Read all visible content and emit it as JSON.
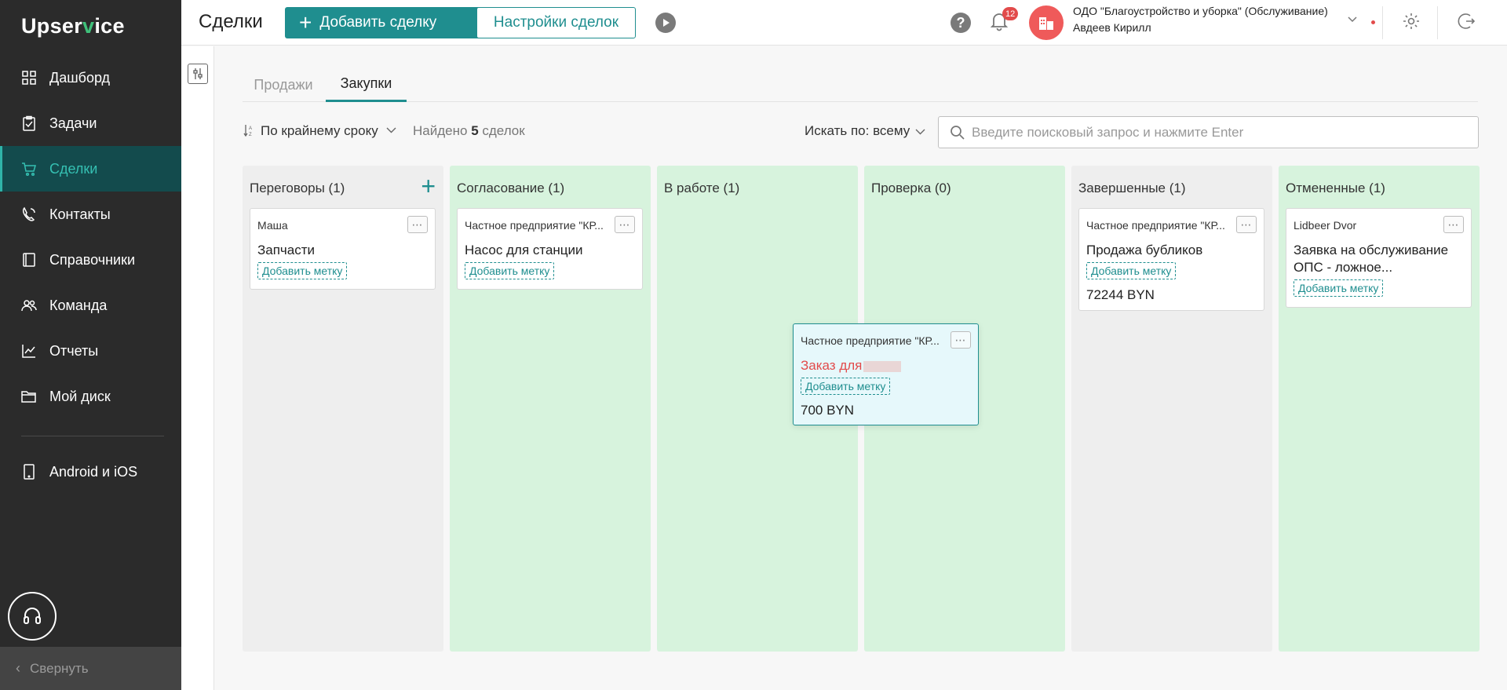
{
  "app": {
    "logo_a": "Upser",
    "logo_v": "v",
    "logo_b": "ice"
  },
  "sidebar": {
    "items": [
      {
        "label": "Дашборд",
        "icon": "dashboard-icon"
      },
      {
        "label": "Задачи",
        "icon": "tasks-icon"
      },
      {
        "label": "Сделки",
        "icon": "deals-icon",
        "active": true
      },
      {
        "label": "Контакты",
        "icon": "contacts-icon"
      },
      {
        "label": "Справочники",
        "icon": "reference-book-icon"
      },
      {
        "label": "Команда",
        "icon": "team-icon"
      },
      {
        "label": "Отчеты",
        "icon": "reports-icon"
      },
      {
        "label": "Мой диск",
        "icon": "folder-icon"
      }
    ],
    "mobile_label": "Android и iOS",
    "collapse_label": "Свернуть"
  },
  "header": {
    "title": "Сделки",
    "add_button": "Добавить сделку",
    "settings_button": "Настройки сделок",
    "notifications_count": "12",
    "org_name": "ОДО \"Благоустройство и уборка\" (Обслуживание)",
    "user_name": "Авдеев Кирилл"
  },
  "tabs": [
    {
      "label": "Продажи",
      "active": false
    },
    {
      "label": "Закупки",
      "active": true
    }
  ],
  "toolbar": {
    "sort_label": "По крайнему сроку",
    "found_prefix": "Найдено",
    "found_count": "5",
    "found_suffix": "сделок",
    "search_by": "Искать по: всему",
    "search_placeholder": "Введите поисковый запрос и нажмите Enter",
    "search_value": ""
  },
  "board": {
    "add_tag_label": "Добавить метку",
    "columns": [
      {
        "title": "Переговоры (1)",
        "color": "gray",
        "cards": [
          {
            "company": "Маша",
            "title": "Запчасти",
            "amount": ""
          }
        ]
      },
      {
        "title": "Согласование (1)",
        "color": "green",
        "cards": [
          {
            "company": "Частное предприятие \"КР...",
            "title": "Насос для станции",
            "amount": ""
          }
        ]
      },
      {
        "title": "В работе (1)",
        "color": "green",
        "cards": []
      },
      {
        "title": "Проверка (0)",
        "color": "green",
        "cards": []
      },
      {
        "title": "Завершенные (1)",
        "color": "gray",
        "cards": [
          {
            "company": "Частное предприятие \"КР...",
            "title": "Продажа бубликов",
            "amount": "72244 BYN"
          }
        ]
      },
      {
        "title": "Отмененные (1)",
        "color": "green",
        "cards": [
          {
            "company": "Lidbeer Dvor",
            "title": "Заявка на обслуживание ОПС - ложное...",
            "amount": ""
          }
        ]
      }
    ],
    "dragging_card": {
      "company": "Частное предприятие \"КР...",
      "title": "Заказ для",
      "title_color": "#e24b4b",
      "amount": "700 BYN"
    }
  },
  "colors": {
    "accent": "#1f8e8f",
    "sidebar_bg": "#2b2b2b",
    "column_green": "#d7f3dd",
    "column_gray": "#eeeeee"
  }
}
